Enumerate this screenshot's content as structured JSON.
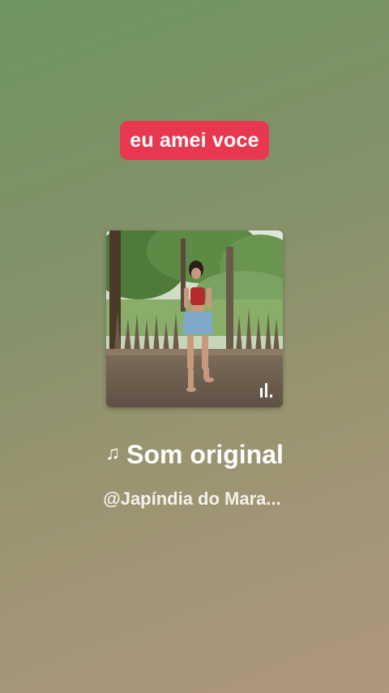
{
  "sticker": {
    "text": "eu amei voce",
    "color": "#e8384f"
  },
  "cover": {
    "description_icon": "bars-logo-icon",
    "equalizer_icon": "bars-logo-icon"
  },
  "sound": {
    "note_icon": "♫",
    "title": "Som original",
    "author": "@Japíndia do Mara..."
  }
}
